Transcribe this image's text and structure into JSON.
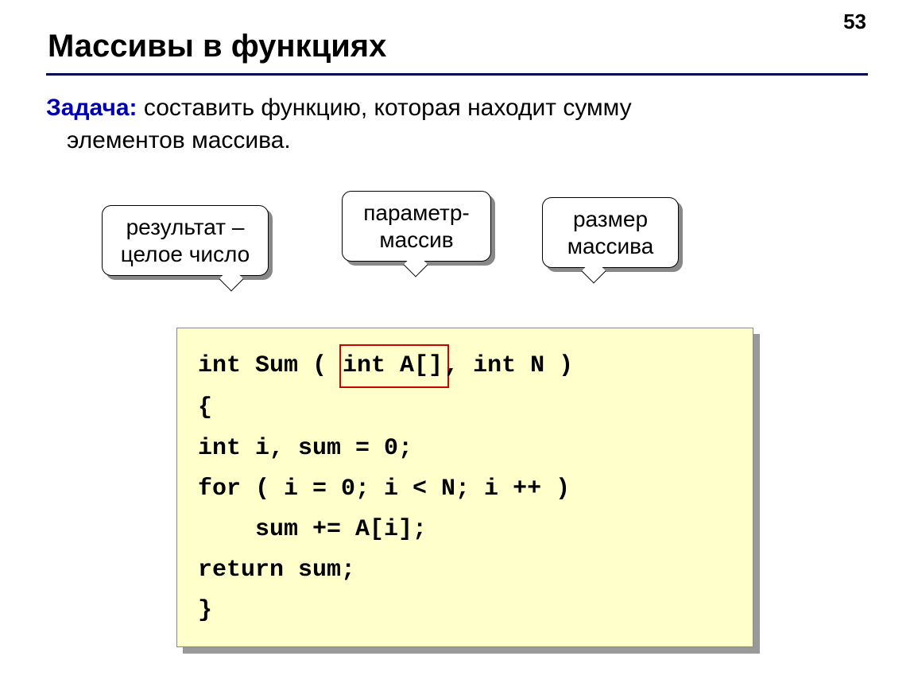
{
  "page_number": "53",
  "title": "Массивы в функциях",
  "task": {
    "label": "Задача:",
    "text_line1": " составить функцию, которая находит сумму",
    "text_line2": "элементов массива."
  },
  "callouts": {
    "c1_line1": "результат –",
    "c1_line2": "целое число",
    "c2_line1": "параметр-",
    "c2_line2": "массив",
    "c3_line1": "размер",
    "c3_line2": "массива"
  },
  "code": {
    "l1a": "int Sum ( ",
    "l1_red": "int A[]",
    "l1b": ", int N )",
    "l2": "{",
    "l3": "int i, sum = 0;",
    "l4": "for ( i = 0; i < N; i ++ )",
    "l5": "    sum += A[i];",
    "l6": "return sum;",
    "l7": "}"
  }
}
